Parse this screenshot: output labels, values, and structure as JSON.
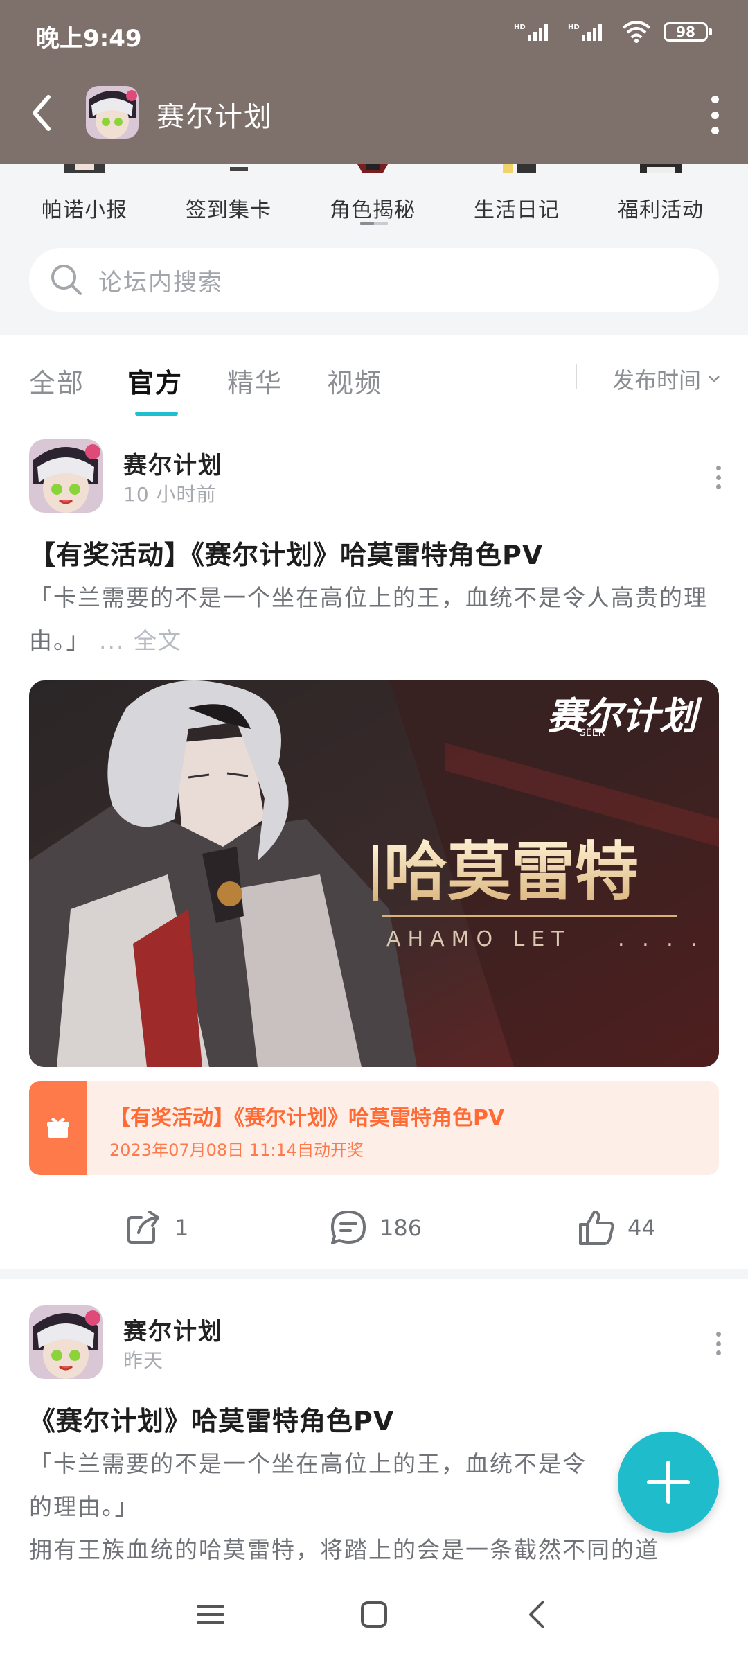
{
  "status_bar": {
    "time": "晚上9:49",
    "battery": "98",
    "signal_label": "HD"
  },
  "app_bar": {
    "title": "赛尔计划"
  },
  "categories": [
    {
      "label": "帕诺小报"
    },
    {
      "label": "签到集卡"
    },
    {
      "label": "角色揭秘"
    },
    {
      "label": "生活日记"
    },
    {
      "label": "福利活动"
    }
  ],
  "search": {
    "placeholder": "论坛内搜索"
  },
  "tabs": [
    {
      "label": "全部"
    },
    {
      "label": "官方"
    },
    {
      "label": "精华"
    },
    {
      "label": "视频"
    }
  ],
  "sort": {
    "label": "发布时间"
  },
  "posts": [
    {
      "author": "赛尔计划",
      "time": "10 小时前",
      "title": "【有奖活动】《赛尔计划》哈莫雷特角色PV",
      "excerpt": "「卡兰需要的不是一个坐在高位上的王，血统不是令人高贵的理由。」",
      "fulltext_label": "... 全文",
      "banner": {
        "logo": "赛尔计划",
        "logo_sub": "SEER",
        "name_cn": "哈莫雷特",
        "name_en": "AHAMO LET"
      },
      "prize": {
        "title": "【有奖活动】《赛尔计划》哈莫雷特角色PV",
        "subtitle": "2023年07月08日 11:14自动开奖"
      },
      "shares": "1",
      "comments": "186",
      "likes": "44"
    },
    {
      "author": "赛尔计划",
      "time": "昨天",
      "title": "《赛尔计划》哈莫雷特角色PV",
      "excerpt_line1": "「卡兰需要的不是一个坐在高位上的王，血统不是令",
      "excerpt_line2": "的理由。」",
      "excerpt_line3": "拥有王族血统的哈莫雷特，将踏上的会是一条截然不同的道"
    }
  ],
  "colors": {
    "accent": "#1fbccc",
    "header_bg": "#7e716c",
    "prize_orange": "#ff7a4a"
  }
}
